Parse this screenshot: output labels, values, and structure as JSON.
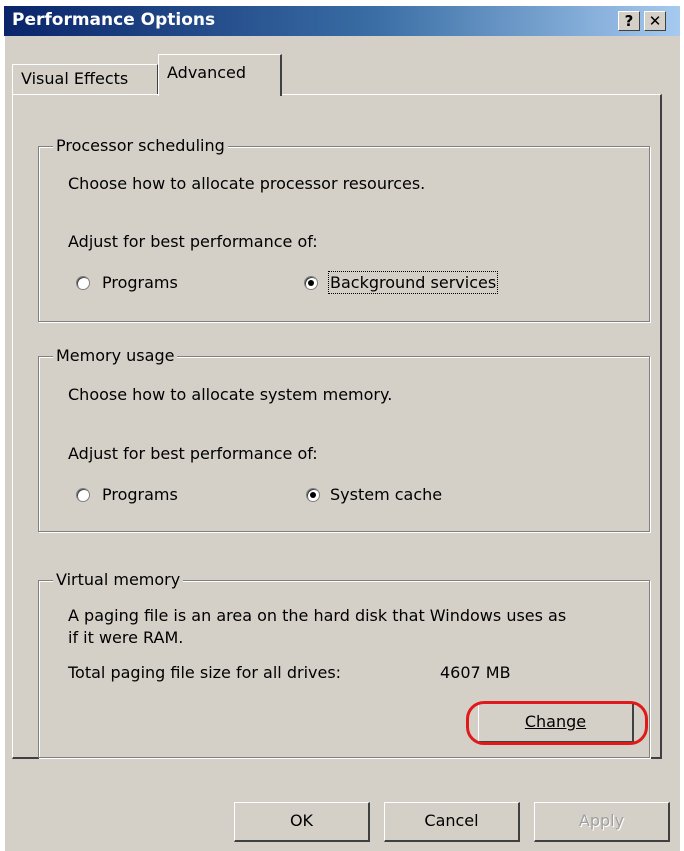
{
  "window": {
    "title": "Performance Options",
    "help_button": "?",
    "close_button": "✕"
  },
  "tabs": [
    {
      "label": "Visual Effects",
      "selected": false
    },
    {
      "label": "Advanced",
      "selected": true
    }
  ],
  "processor": {
    "legend": "Processor scheduling",
    "description": "Choose how to allocate processor resources.",
    "adjust_label": "Adjust for best performance of:",
    "options": [
      {
        "label": "Programs",
        "checked": false
      },
      {
        "label": "Background services",
        "checked": true
      }
    ]
  },
  "memory": {
    "legend": "Memory usage",
    "description": "Choose how to allocate system memory.",
    "adjust_label": "Adjust for best performance of:",
    "options": [
      {
        "label": "Programs",
        "checked": false
      },
      {
        "label": "System cache",
        "checked": true
      }
    ]
  },
  "virtual_memory": {
    "legend": "Virtual memory",
    "description_line1": "A paging file is an area on the hard disk that Windows uses as",
    "description_line2": "if it were RAM.",
    "total_label": "Total paging file size for all drives:",
    "total_value": "4607 MB",
    "change_button": "Change"
  },
  "footer": {
    "ok": "OK",
    "cancel": "Cancel",
    "apply": "Apply"
  },
  "colors": {
    "highlight": "#e01a1a",
    "title_start": "#0a246a",
    "title_end": "#a6caf0",
    "face": "#d4d0c8"
  }
}
